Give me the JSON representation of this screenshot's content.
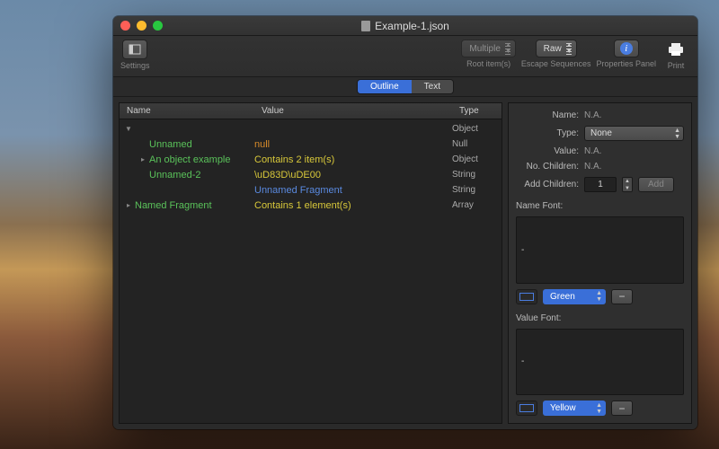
{
  "window": {
    "title": "Example-1.json"
  },
  "toolbar": {
    "settings_label": "Settings",
    "root_items": {
      "label": "Root item(s)",
      "value": "Multiple"
    },
    "escape_seq": {
      "label": "Escape Sequences",
      "value": "Raw"
    },
    "properties_panel_label": "Properties Panel",
    "print_label": "Print"
  },
  "tabs": {
    "outline": "Outline",
    "text": "Text",
    "active": "outline"
  },
  "tree": {
    "headers": {
      "name": "Name",
      "value": "Value",
      "type": "Type"
    },
    "rows": [
      {
        "indent": 0,
        "tri": "▼",
        "name": "",
        "name_color": "",
        "value": "",
        "value_color": "",
        "type": "Object"
      },
      {
        "indent": 1,
        "tri": "",
        "name": "Unnamed",
        "name_color": "c-green",
        "value": "null",
        "value_color": "c-orange",
        "type": "Null"
      },
      {
        "indent": 1,
        "tri": "▸",
        "name": "An object example",
        "name_color": "c-green",
        "value": "Contains 2 item(s)",
        "value_color": "c-yellow",
        "type": "Object"
      },
      {
        "indent": 1,
        "tri": "",
        "name": "Unnamed-2",
        "name_color": "c-green",
        "value": "\\uD83D\\uDE00",
        "value_color": "c-yellow",
        "type": "String"
      },
      {
        "indent": 1,
        "tri": "",
        "name": "",
        "name_color": "",
        "value": "Unnamed Fragment",
        "value_color": "c-blue",
        "type": "String"
      },
      {
        "indent": 0,
        "tri": "▸",
        "name": "Named Fragment",
        "name_color": "c-green",
        "value": "Contains 1 element(s)",
        "value_color": "c-yellow",
        "type": "Array"
      }
    ]
  },
  "props": {
    "labels": {
      "name": "Name:",
      "type": "Type:",
      "value": "Value:",
      "no_children": "No. Children:",
      "add_children": "Add Children:",
      "name_font": "Name Font:",
      "value_font": "Value Font:"
    },
    "name_value": "N.A.",
    "type_value": "None",
    "value_value": "N.A.",
    "no_children_value": "N.A.",
    "add_children_value": "1",
    "add_button": "Add",
    "name_font": {
      "style": "-",
      "color": "Green"
    },
    "value_font": {
      "style": "-",
      "color": "Yellow"
    }
  }
}
